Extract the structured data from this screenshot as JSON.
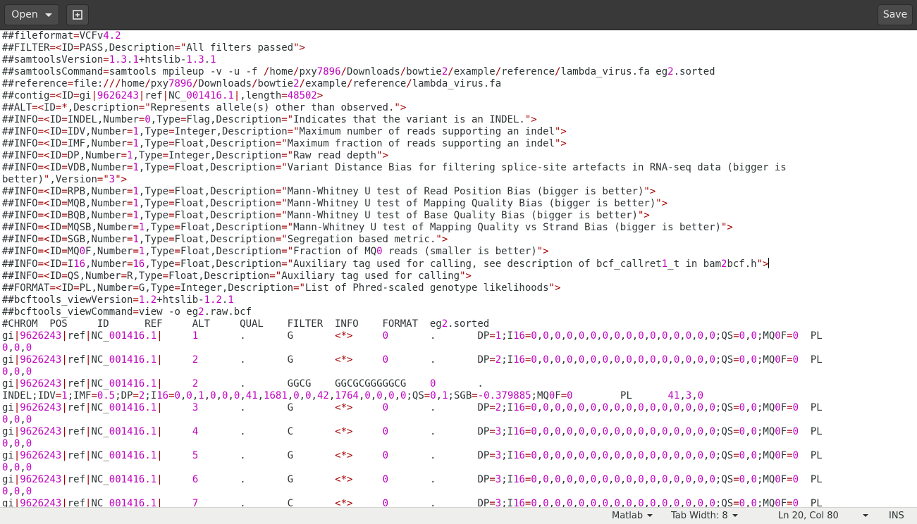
{
  "header": {
    "open_label": "Open",
    "new_tab_icon": "new-document-icon",
    "save_label": "Save"
  },
  "editor": {
    "lines": [
      "##fileformat=VCFv4.2",
      "##FILTER=<ID=PASS,Description=\"All filters passed\">",
      "##samtoolsVersion=1.3.1+htslib-1.3.1",
      "##samtoolsCommand=samtools mpileup -v -u -f /home/pxy7896/Downloads/bowtie2/example/reference/lambda_virus.fa eg2.sorted",
      "##reference=file:///home/pxy7896/Downloads/bowtie2/example/reference/lambda_virus.fa",
      "##contig=<ID=gi|9626243|ref|NC_001416.1|,length=48502>",
      "##ALT=<ID=*,Description=\"Represents allele(s) other than observed.\">",
      "##INFO=<ID=INDEL,Number=0,Type=Flag,Description=\"Indicates that the variant is an INDEL.\">",
      "##INFO=<ID=IDV,Number=1,Type=Integer,Description=\"Maximum number of reads supporting an indel\">",
      "##INFO=<ID=IMF,Number=1,Type=Float,Description=\"Maximum fraction of reads supporting an indel\">",
      "##INFO=<ID=DP,Number=1,Type=Integer,Description=\"Raw read depth\">",
      "##INFO=<ID=VDB,Number=1,Type=Float,Description=\"Variant Distance Bias for filtering splice-site artefacts in RNA-seq data (bigger is",
      "better)\",Version=\"3\">",
      "##INFO=<ID=RPB,Number=1,Type=Float,Description=\"Mann-Whitney U test of Read Position Bias (bigger is better)\">",
      "##INFO=<ID=MQB,Number=1,Type=Float,Description=\"Mann-Whitney U test of Mapping Quality Bias (bigger is better)\">",
      "##INFO=<ID=BQB,Number=1,Type=Float,Description=\"Mann-Whitney U test of Base Quality Bias (bigger is better)\">",
      "##INFO=<ID=MQSB,Number=1,Type=Float,Description=\"Mann-Whitney U test of Mapping Quality vs Strand Bias (bigger is better)\">",
      "##INFO=<ID=SGB,Number=1,Type=Float,Description=\"Segregation based metric.\">",
      "##INFO=<ID=MQ0F,Number=1,Type=Float,Description=\"Fraction of MQ0 reads (smaller is better)\">",
      "##INFO=<ID=I16,Number=16,Type=Float,Description=\"Auxiliary tag used for calling, see description of bcf_callret1_t in bam2bcf.h\">",
      "##INFO=<ID=QS,Number=R,Type=Float,Description=\"Auxiliary tag used for calling\">",
      "##FORMAT=<ID=PL,Number=G,Type=Integer,Description=\"List of Phred-scaled genotype likelihoods\">",
      "##bcftools_viewVersion=1.2+htslib-1.2.1",
      "##bcftools_viewCommand=view -o eg2.raw.bcf",
      "#CHROM  POS     ID      REF     ALT     QUAL    FILTER  INFO    FORMAT  eg2.sorted",
      "gi|9626243|ref|NC_001416.1|     1       .       G       <*>     0       .       DP=1;I16=0,0,0,0,0,0,0,0,0,0,0,0,0,0,0,0;QS=0,0;MQ0F=0  PL",
      "0,0,0",
      "gi|9626243|ref|NC_001416.1|     2       .       G       <*>     0       .       DP=2;I16=0,0,0,0,0,0,0,0,0,0,0,0,0,0,0,0;QS=0,0;MQ0F=0  PL",
      "0,0,0",
      "gi|9626243|ref|NC_001416.1|     2       .       GGCG    GGCGCGGGGGCG    0       .",
      "INDEL;IDV=1;IMF=0.5;DP=2;I16=0,0,1,0,0,0,41,1681,0,0,42,1764,0,0,0,0;QS=0,1;SGB=-0.379885;MQ0F=0        PL      41,3,0",
      "gi|9626243|ref|NC_001416.1|     3       .       G       <*>     0       .       DP=2;I16=0,0,0,0,0,0,0,0,0,0,0,0,0,0,0,0;QS=0,0;MQ0F=0  PL",
      "0,0,0",
      "gi|9626243|ref|NC_001416.1|     4       .       C       <*>     0       .       DP=3;I16=0,0,0,0,0,0,0,0,0,0,0,0,0,0,0,0;QS=0,0;MQ0F=0  PL",
      "0,0,0",
      "gi|9626243|ref|NC_001416.1|     5       .       G       <*>     0       .       DP=3;I16=0,0,0,0,0,0,0,0,0,0,0,0,0,0,0,0;QS=0,0;MQ0F=0  PL",
      "0,0,0",
      "gi|9626243|ref|NC_001416.1|     6       .       G       <*>     0       .       DP=3;I16=0,0,0,0,0,0,0,0,0,0,0,0,0,0,0,0;QS=0,0;MQ0F=0  PL",
      "0,0,0",
      "gi|9626243|ref|NC_001416.1|     7       .       C       <*>     0       .       DP=3;I16=0,0,0,0,0,0,0,0,0,0,0,0,0,0,0,0;QS=0,0;MQ0F=0  PL"
    ],
    "cursor_line": 20
  },
  "statusbar": {
    "language": "Matlab",
    "tab_width": "Tab Width: 8",
    "position": "Ln 20, Col 80",
    "mode": "INS"
  },
  "colors": {
    "header_bg": "#393939",
    "keyword": "#a40000",
    "number": "#c000c0",
    "type": "#008b8b"
  }
}
